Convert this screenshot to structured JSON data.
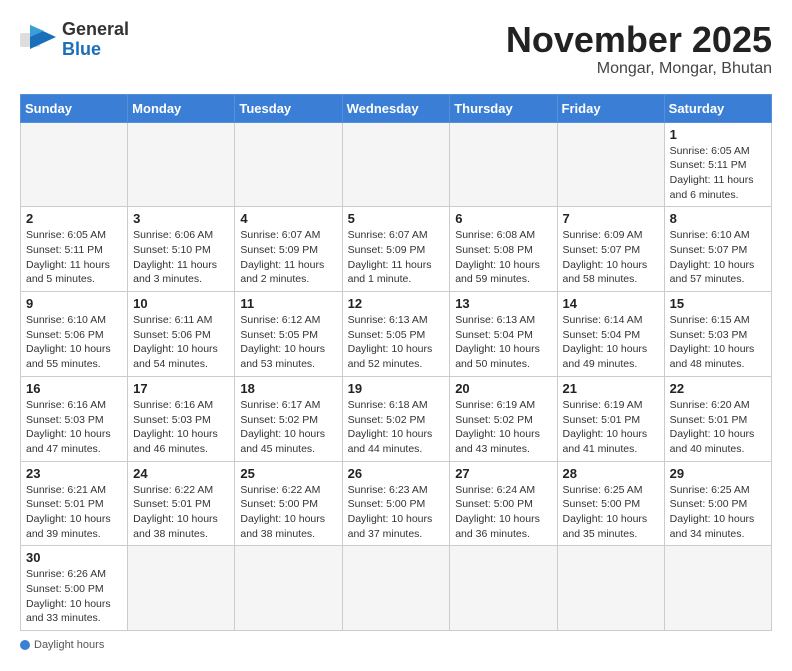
{
  "header": {
    "logo_general": "General",
    "logo_blue": "Blue",
    "month_title": "November 2025",
    "location": "Mongar, Mongar, Bhutan"
  },
  "weekdays": [
    "Sunday",
    "Monday",
    "Tuesday",
    "Wednesday",
    "Thursday",
    "Friday",
    "Saturday"
  ],
  "footer": {
    "daylight_hours": "Daylight hours"
  },
  "days": [
    {
      "number": "",
      "info": ""
    },
    {
      "number": "",
      "info": ""
    },
    {
      "number": "",
      "info": ""
    },
    {
      "number": "",
      "info": ""
    },
    {
      "number": "",
      "info": ""
    },
    {
      "number": "",
      "info": ""
    },
    {
      "number": "1",
      "info": "Sunrise: 6:05 AM\nSunset: 5:11 PM\nDaylight: 11 hours and 6 minutes."
    },
    {
      "number": "2",
      "info": "Sunrise: 6:05 AM\nSunset: 5:11 PM\nDaylight: 11 hours and 5 minutes."
    },
    {
      "number": "3",
      "info": "Sunrise: 6:06 AM\nSunset: 5:10 PM\nDaylight: 11 hours and 3 minutes."
    },
    {
      "number": "4",
      "info": "Sunrise: 6:07 AM\nSunset: 5:09 PM\nDaylight: 11 hours and 2 minutes."
    },
    {
      "number": "5",
      "info": "Sunrise: 6:07 AM\nSunset: 5:09 PM\nDaylight: 11 hours and 1 minute."
    },
    {
      "number": "6",
      "info": "Sunrise: 6:08 AM\nSunset: 5:08 PM\nDaylight: 10 hours and 59 minutes."
    },
    {
      "number": "7",
      "info": "Sunrise: 6:09 AM\nSunset: 5:07 PM\nDaylight: 10 hours and 58 minutes."
    },
    {
      "number": "8",
      "info": "Sunrise: 6:10 AM\nSunset: 5:07 PM\nDaylight: 10 hours and 57 minutes."
    },
    {
      "number": "9",
      "info": "Sunrise: 6:10 AM\nSunset: 5:06 PM\nDaylight: 10 hours and 55 minutes."
    },
    {
      "number": "10",
      "info": "Sunrise: 6:11 AM\nSunset: 5:06 PM\nDaylight: 10 hours and 54 minutes."
    },
    {
      "number": "11",
      "info": "Sunrise: 6:12 AM\nSunset: 5:05 PM\nDaylight: 10 hours and 53 minutes."
    },
    {
      "number": "12",
      "info": "Sunrise: 6:13 AM\nSunset: 5:05 PM\nDaylight: 10 hours and 52 minutes."
    },
    {
      "number": "13",
      "info": "Sunrise: 6:13 AM\nSunset: 5:04 PM\nDaylight: 10 hours and 50 minutes."
    },
    {
      "number": "14",
      "info": "Sunrise: 6:14 AM\nSunset: 5:04 PM\nDaylight: 10 hours and 49 minutes."
    },
    {
      "number": "15",
      "info": "Sunrise: 6:15 AM\nSunset: 5:03 PM\nDaylight: 10 hours and 48 minutes."
    },
    {
      "number": "16",
      "info": "Sunrise: 6:16 AM\nSunset: 5:03 PM\nDaylight: 10 hours and 47 minutes."
    },
    {
      "number": "17",
      "info": "Sunrise: 6:16 AM\nSunset: 5:03 PM\nDaylight: 10 hours and 46 minutes."
    },
    {
      "number": "18",
      "info": "Sunrise: 6:17 AM\nSunset: 5:02 PM\nDaylight: 10 hours and 45 minutes."
    },
    {
      "number": "19",
      "info": "Sunrise: 6:18 AM\nSunset: 5:02 PM\nDaylight: 10 hours and 44 minutes."
    },
    {
      "number": "20",
      "info": "Sunrise: 6:19 AM\nSunset: 5:02 PM\nDaylight: 10 hours and 43 minutes."
    },
    {
      "number": "21",
      "info": "Sunrise: 6:19 AM\nSunset: 5:01 PM\nDaylight: 10 hours and 41 minutes."
    },
    {
      "number": "22",
      "info": "Sunrise: 6:20 AM\nSunset: 5:01 PM\nDaylight: 10 hours and 40 minutes."
    },
    {
      "number": "23",
      "info": "Sunrise: 6:21 AM\nSunset: 5:01 PM\nDaylight: 10 hours and 39 minutes."
    },
    {
      "number": "24",
      "info": "Sunrise: 6:22 AM\nSunset: 5:01 PM\nDaylight: 10 hours and 38 minutes."
    },
    {
      "number": "25",
      "info": "Sunrise: 6:22 AM\nSunset: 5:00 PM\nDaylight: 10 hours and 38 minutes."
    },
    {
      "number": "26",
      "info": "Sunrise: 6:23 AM\nSunset: 5:00 PM\nDaylight: 10 hours and 37 minutes."
    },
    {
      "number": "27",
      "info": "Sunrise: 6:24 AM\nSunset: 5:00 PM\nDaylight: 10 hours and 36 minutes."
    },
    {
      "number": "28",
      "info": "Sunrise: 6:25 AM\nSunset: 5:00 PM\nDaylight: 10 hours and 35 minutes."
    },
    {
      "number": "29",
      "info": "Sunrise: 6:25 AM\nSunset: 5:00 PM\nDaylight: 10 hours and 34 minutes."
    },
    {
      "number": "30",
      "info": "Sunrise: 6:26 AM\nSunset: 5:00 PM\nDaylight: 10 hours and 33 minutes."
    }
  ]
}
